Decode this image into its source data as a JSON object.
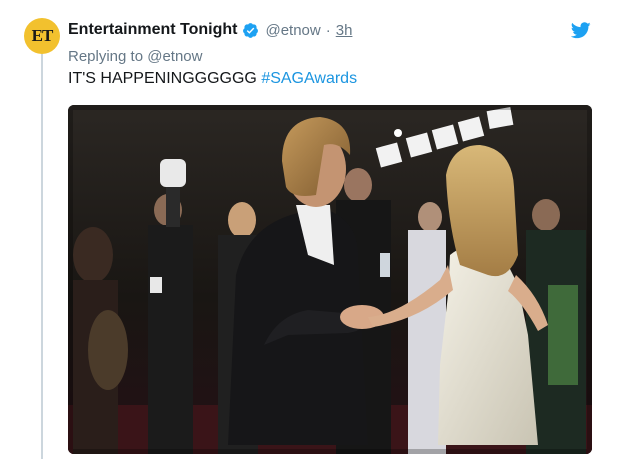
{
  "tweet": {
    "avatar_text": "ET",
    "display_name": "Entertainment Tonight",
    "handle": "@etnow",
    "separator": "·",
    "timestamp": "3h",
    "reply_prefix": "Replying to",
    "reply_handle": "@etnow",
    "text": "IT'S HAPPENINGGGGGG",
    "hashtag": "#SAGAwards",
    "verified": true
  },
  "icons": {
    "verified": "verified-badge-icon",
    "brand": "twitter-bird-icon"
  },
  "colors": {
    "brand_blue": "#1da1f2",
    "link_blue": "#1b95e0",
    "muted_gray": "#657786",
    "avatar_yellow": "#f2c12e",
    "thread_line": "#ccd6dd"
  }
}
